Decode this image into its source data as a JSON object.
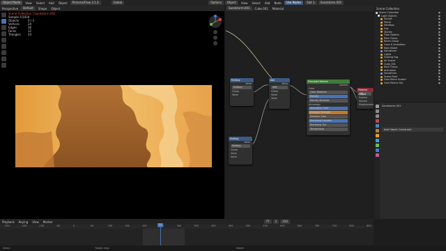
{
  "topbar": {
    "menus": [
      "Object Mode",
      "View",
      "Select",
      "Add",
      "Object",
      "Pictures/Flow 3.1.3"
    ],
    "viewport_tools": [
      "Global",
      "Options"
    ],
    "node_menus": [
      "Object",
      "View",
      "Select",
      "Add",
      "Node",
      "Use Nodes",
      "Slot 1",
      "Material"
    ],
    "material_name": "Sandstorm.001"
  },
  "viewport": {
    "header": [
      "Perspective",
      "Default",
      "Shape",
      "Object"
    ],
    "stats": {
      "title": "Scene Collection | Sandstorm.001",
      "sample": "Sample 1/1024",
      "rows": [
        {
          "k": "Objects",
          "v": "0 / 3"
        },
        {
          "k": "Vertices",
          "v": "24"
        },
        {
          "k": "Edges",
          "v": "36"
        },
        {
          "k": "Faces",
          "v": "12"
        },
        {
          "k": "Triangles",
          "v": "24"
        }
      ]
    }
  },
  "node_editor": {
    "header": [
      "Sandstorm.001",
      "Cube.001",
      "Material"
    ],
    "nodes": [
      {
        "title": "Multiply",
        "rows": [
          "Value",
          "Multiply",
          "Clamp",
          "Value"
        ]
      },
      {
        "title": "Add",
        "rows": [
          "Value",
          "Add",
          "Clamp",
          "Value",
          "Value"
        ]
      },
      {
        "title": "Multiply",
        "rows": [
          "Value",
          "Multiply",
          "Clamp",
          "Value",
          "Value"
        ]
      },
      {
        "title": "Principled Volume",
        "rows": [
          "Volume",
          "Color",
          "Color Attribute",
          "Density",
          "Density Attribute",
          "Anisotropy",
          "Absorption Color",
          "Emission Strength",
          "Emission Color",
          "Blackbody Intensity",
          "Blackbody Tint",
          "Temperature",
          "Temperature Att"
        ]
      },
      {
        "title": "Material Output",
        "rows": [
          "All",
          "Surface",
          "Volume",
          "Displacement"
        ]
      }
    ]
  },
  "outliner": {
    "header": "Scene Collection",
    "items": [
      {
        "label": "Scene Collection",
        "color": "#cfcfcf"
      },
      {
        "label": "Light Objects",
        "color": "#e0e0e0"
      },
      {
        "label": "Sunset",
        "color": "#e0a030"
      },
      {
        "label": "Portal",
        "color": "#e0a030"
      },
      {
        "label": "Sandbox",
        "color": "#e0a030"
      },
      {
        "label": "Fog",
        "color": "#e0a030"
      },
      {
        "label": "Stones",
        "color": "#e0a030"
      },
      {
        "label": "Flow Objects",
        "color": "#e0a030"
      },
      {
        "label": "Rock Group",
        "color": "#e0a030"
      },
      {
        "label": "Rocks Group",
        "color": "#e0a030"
      },
      {
        "label": "Cave & Animation",
        "color": "#e0a030"
      },
      {
        "label": "Main Model",
        "color": "#e0a030"
      },
      {
        "label": "Sandstorm",
        "color": "#6a9fe0"
      },
      {
        "label": "Lights",
        "color": "#e0a030"
      },
      {
        "label": "Dusting Fog",
        "color": "#e0a030"
      },
      {
        "label": "All Scales",
        "color": "#e0a030"
      },
      {
        "label": "Cube_001",
        "color": "#e0a030"
      },
      {
        "label": "Rock Group",
        "color": "#e0a030"
      },
      {
        "label": "Animation",
        "color": "#e0a030"
      },
      {
        "label": "Sandstorm",
        "color": "#6a9fe0"
      },
      {
        "label": "Scene Rock",
        "color": "#e0a030"
      },
      {
        "label": "Gold Stone Scatter",
        "color": "#e0a030"
      },
      {
        "label": "Gold Marine Sky",
        "color": "#e0a030"
      }
    ]
  },
  "properties": {
    "object_name": "Sandstorm.001",
    "add_button": "Add Object Constraint"
  },
  "timeline": {
    "menus": [
      "Playback",
      "Keying",
      "View",
      "Marker"
    ],
    "current_frame": "77",
    "frame_start": "1",
    "frame_end": "250",
    "ticks": [
      "-250",
      "-150",
      "-100",
      "-50",
      "0",
      "50",
      "100",
      "150",
      "200",
      "250",
      "300",
      "350",
      "400",
      "450",
      "500",
      "550",
      "600",
      "650",
      "700",
      "750",
      "800",
      "850"
    ]
  },
  "statusbar": [
    "Select",
    "Rotate View",
    "Object"
  ]
}
